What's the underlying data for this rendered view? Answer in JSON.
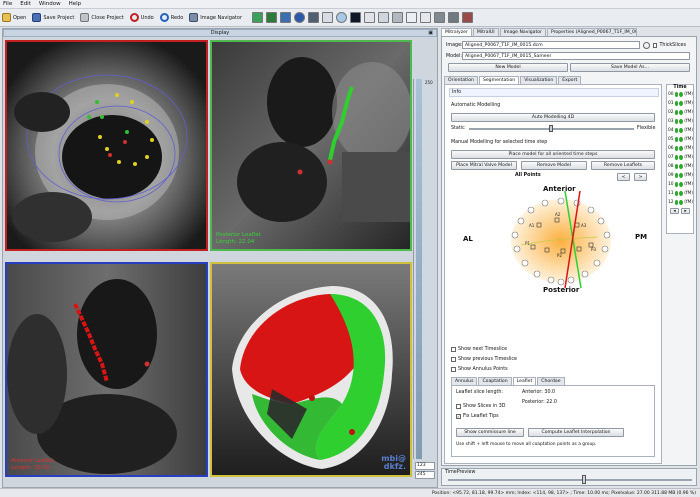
{
  "menu": [
    "File",
    "Edit",
    "Window",
    "Help"
  ],
  "toolbar": {
    "open": "Open",
    "save_project": "Save Project",
    "close_project": "Close Project",
    "undo": "Undo",
    "redo": "Redo",
    "image_navigator": "Image Navigator"
  },
  "display_panel": {
    "title": "Display",
    "top_right_label_line1": "Posterior Leaflet",
    "top_right_label_line2": "Length: 22.04",
    "bottom_left_label_line1": "Anterior Leaflet",
    "bottom_left_label_line2": "Length: 30.00",
    "watermark_line1": "mbi@",
    "watermark_line2": "dkfz.",
    "ruler_top_value": "250",
    "ruler_bottom_value1": "123",
    "ruler_bottom_value2": "245"
  },
  "right_tabs": [
    {
      "label": "Mitralyzer",
      "active": true
    },
    {
      "label": "MitralUI",
      "active": false
    },
    {
      "label": "Image Navigator",
      "active": false
    },
    {
      "label": "Properties (Aligned_P0067_T1F_IM_001...",
      "active": false
    }
  ],
  "mitralyzer": {
    "image_label": "Image:",
    "image_value": "Aligned_P0067_T1F_IM_0015.dcm",
    "thick_slices": "ThickSlices",
    "model_label": "Model:",
    "model_value": "Aligned_P0067_T1F_IM_0015_Sameer",
    "new_model": "New Model",
    "save_model": "Save Model As...",
    "subtabs": [
      "Orientation",
      "Segmentation",
      "Visualization",
      "Export"
    ],
    "active_subtab": "Segmentation",
    "info_label": "Info",
    "automatic_modelling": "Automatic Modelling",
    "auto_modelling_4d": "Auto Modelling 4D",
    "static_label": "Static",
    "flexible_label": "Flexible",
    "manual_modelling": "Manual Modelling for selected time step",
    "place_model": "Place model for all oriented time steps",
    "place_mitral_valve": "Place Mitral Valve Model",
    "remove_model": "Remove Model",
    "remove_leaflets": "Remove Leaflets",
    "prev_arrow": "<",
    "next_arrow": ">",
    "all_points": "All Points",
    "anterior": "Anterior",
    "posterior": "Posterior",
    "al": "AL",
    "pm": "PM",
    "show_next_timeslice": "Show next Timeslice",
    "show_previous_timeslice": "Show previous Timeslice",
    "show_annulus_points": "Show Annulus Points",
    "bottom_tabs": [
      "Annulus",
      "Coaptation",
      "Leaflet",
      "Chordae"
    ],
    "active_bottom_tab": "Leaflet",
    "leaflet_slice_length": "Leaflet slice length:",
    "anterior_value": "Anterior: 30.0",
    "posterior_value": "Posterior: 22.0",
    "show_slices_3d": "Show Slices in 3D",
    "fix_leaflet_tips": "Fix Leaflet Tips",
    "show_commissure": "Show commissure line",
    "compute_interpolation": "Compute Leaflet Interpolation",
    "hint": "Use shift + left mouse to move all coaptation points as a group."
  },
  "time_panel": {
    "title": "Time",
    "rows": [
      "00",
      "01",
      "02",
      "03",
      "04",
      "05",
      "06",
      "07",
      "08",
      "09",
      "10",
      "11",
      "12"
    ],
    "suffix": "(fM)"
  },
  "timepreview": "TimePreview",
  "status": "Position: <95.72, 81.18, 99.74> mm; Index: <114, 98, 137> ; Time: 10.00 ms; Pixelvalue: 27.00   311.88 MB (0.96 %)",
  "colors": {
    "anterior_leaflet": "#d81515",
    "posterior_leaflet": "#2fcf2f",
    "vp_top_left": "#c22020",
    "vp_top_right": "#4fb84f",
    "vp_bottom_left": "#2a3fbf",
    "vp_bottom_right": "#d0c040"
  }
}
